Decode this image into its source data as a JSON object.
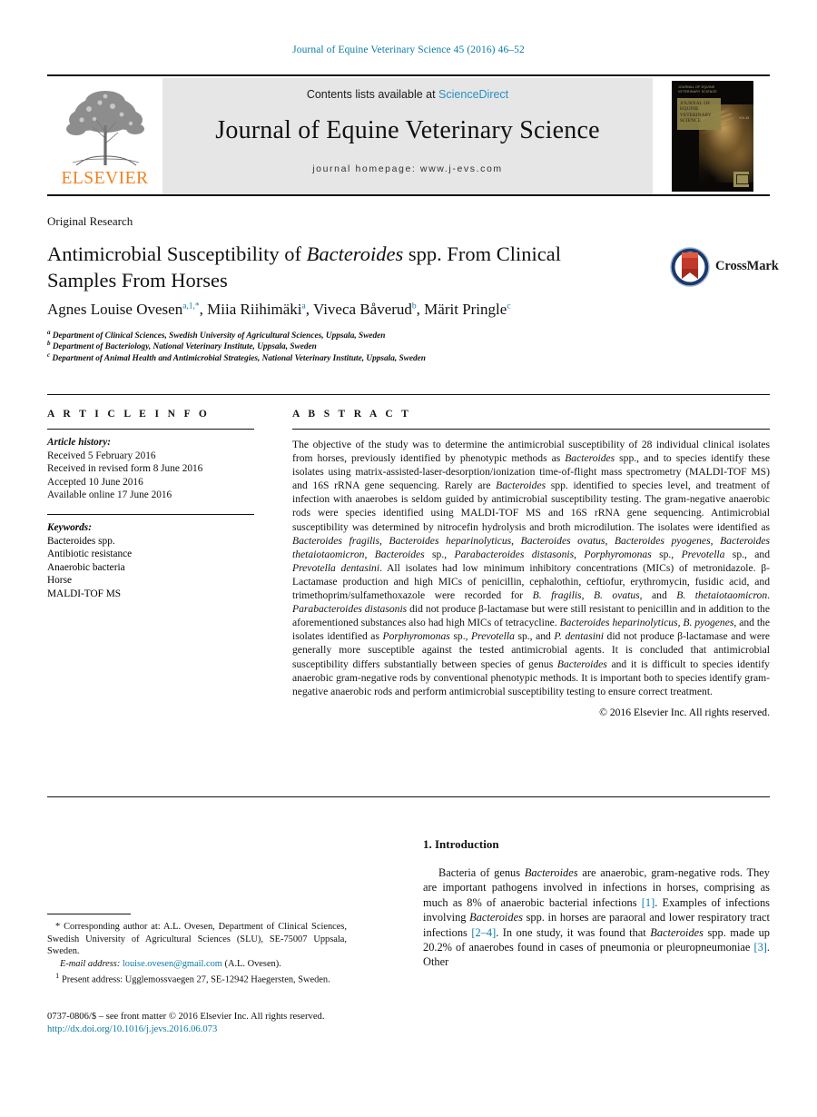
{
  "running_head": "Journal of Equine Veterinary Science 45 (2016) 46–52",
  "masthead": {
    "contents_prefix": "Contents lists available at ",
    "sciencedirect": "ScienceDirect",
    "journal_title": "Journal of Equine Veterinary Science",
    "homepage": "journal homepage: www.j-evs.com",
    "publisher_wordmark": "ELSEVIER",
    "cover": {
      "top_line": "JOURNAL OF EQUINE\nVETERINARY SCIENCE",
      "panel_title": "JOURNAL OF\nEQUINE\nVETERINARY\nSCIENCE",
      "issue_note": "VOLUME 45"
    }
  },
  "article": {
    "section_type": "Original Research",
    "title_part1": "Antimicrobial Susceptibility of ",
    "title_italic": "Bacteroides",
    "title_part2": " spp. From Clinical Samples From Horses",
    "crossmark_label": "CrossMark",
    "authors": [
      {
        "name": "Agnes Louise Ovesen",
        "marks": "a,1,*"
      },
      {
        "name": "Miia Riihimäki",
        "marks": "a"
      },
      {
        "name": "Viveca Båverud",
        "marks": "b"
      },
      {
        "name": "Märit Pringle",
        "marks": "c"
      }
    ],
    "affiliations": [
      {
        "mark": "a",
        "text": "Department of Clinical Sciences, Swedish University of Agricultural Sciences, Uppsala, Sweden"
      },
      {
        "mark": "b",
        "text": "Department of Bacteriology, National Veterinary Institute, Uppsala, Sweden"
      },
      {
        "mark": "c",
        "text": "Department of Animal Health and Antimicrobial Strategies, National Veterinary Institute, Uppsala, Sweden"
      }
    ]
  },
  "article_info": {
    "heading": "A R T I C L E  I N F O",
    "history_label": "Article history:",
    "history": [
      "Received 5 February 2016",
      "Received in revised form 8 June 2016",
      "Accepted 10 June 2016",
      "Available online 17 June 2016"
    ],
    "keywords_label": "Keywords:",
    "keywords": [
      "Bacteroides spp.",
      "Antibiotic resistance",
      "Anaerobic bacteria",
      "Horse",
      "MALDI-TOF MS"
    ]
  },
  "abstract": {
    "heading": "A B S T R A C T",
    "text": "The objective of the study was to determine the antimicrobial susceptibility of 28 individual clinical isolates from horses, previously identified by phenotypic methods as <em>Bacteroides</em> spp., and to species identify these isolates using matrix-assisted-laser-desorption/ionization time-of-flight mass spectrometry (MALDI-TOF MS) and 16S rRNA gene sequencing. Rarely are <em>Bacteroides</em> spp. identified to species level, and treatment of infection with anaerobes is seldom guided by antimicrobial susceptibility testing. The gram-negative anaerobic rods were species identified using MALDI-TOF MS and 16S rRNA gene sequencing. Antimicrobial susceptibility was determined by nitrocefin hydrolysis and broth microdilution. The isolates were identified as <em>Bacteroides fragilis</em>, <em>Bacteroides heparinolyticus</em>, <em>Bacteroides ovatus</em>, <em>Bacteroides pyogenes</em>, <em>Bacteroides thetaiotaomicron</em>, <em>Bacteroides</em> sp., <em>Parabacteroides distasonis</em>, <em>Porphyromonas</em> sp., <em>Prevotella</em> sp., and <em>Prevotella dentasini</em>. All isolates had low minimum inhibitory concentrations (MICs) of metronidazole. β-Lactamase production and high MICs of penicillin, cephalothin, ceftiofur, erythromycin, fusidic acid, and trimethoprim/sulfamethoxazole were recorded for <em>B. fragilis</em>, <em>B. ovatus</em>, and <em>B. thetaiotaomicron</em>. <em>Parabacteroides distasonis</em> did not produce β-lactamase but were still resistant to penicillin and in addition to the aforementioned substances also had high MICs of tetracycline. <em>Bacteroides heparinolyticus</em>, <em>B. pyogenes</em>, and the isolates identified as <em>Porphyromonas</em> sp., <em>Prevotella</em> sp., and <em>P. dentasini</em> did not produce β-lactamase and were generally more susceptible against the tested antimicrobial agents. It is concluded that antimicrobial susceptibility differs substantially between species of genus <em>Bacteroides</em> and it is difficult to species identify anaerobic gram-negative rods by conventional phenotypic methods. It is important both to species identify gram-negative anaerobic rods and perform antimicrobial susceptibility testing to ensure correct treatment.",
    "copyright": "© 2016 Elsevier Inc. All rights reserved."
  },
  "introduction": {
    "heading": "1. Introduction",
    "paragraph": "Bacteria of genus <em>Bacteroides</em> are anaerobic, gram-negative rods. They are important pathogens involved in infections in horses, comprising as much as 8% of anaerobic bacterial infections <span class=\"ref\">[1]</span>. Examples of infections involving <em>Bacteroides</em> spp. in horses are paraoral and lower respiratory tract infections <span class=\"ref\">[2–4]</span>. In one study, it was found that <em>Bacteroides</em> spp. made up 20.2% of anaerobes found in cases of pneumonia or pleuropneumoniae <span class=\"ref\">[3]</span>. Other"
  },
  "footnotes": {
    "corresponding": "* Corresponding author at: A.L. Ovesen, Department of Clinical Sciences, Swedish University of Agricultural Sciences (SLU), SE-75007 Uppsala, Sweden.",
    "email_label": "E-mail address:",
    "email": "louise.ovesen@gmail.com",
    "email_suffix": " (A.L. Ovesen).",
    "present_address": "1 Present address: Ugglemossvaegen 27, SE-12942 Haegersten, Sweden."
  },
  "imprint": {
    "issn_line": "0737-0806/$ – see front matter © 2016 Elsevier Inc. All rights reserved.",
    "doi": "http://dx.doi.org/10.1016/j.jevs.2016.06.073"
  }
}
